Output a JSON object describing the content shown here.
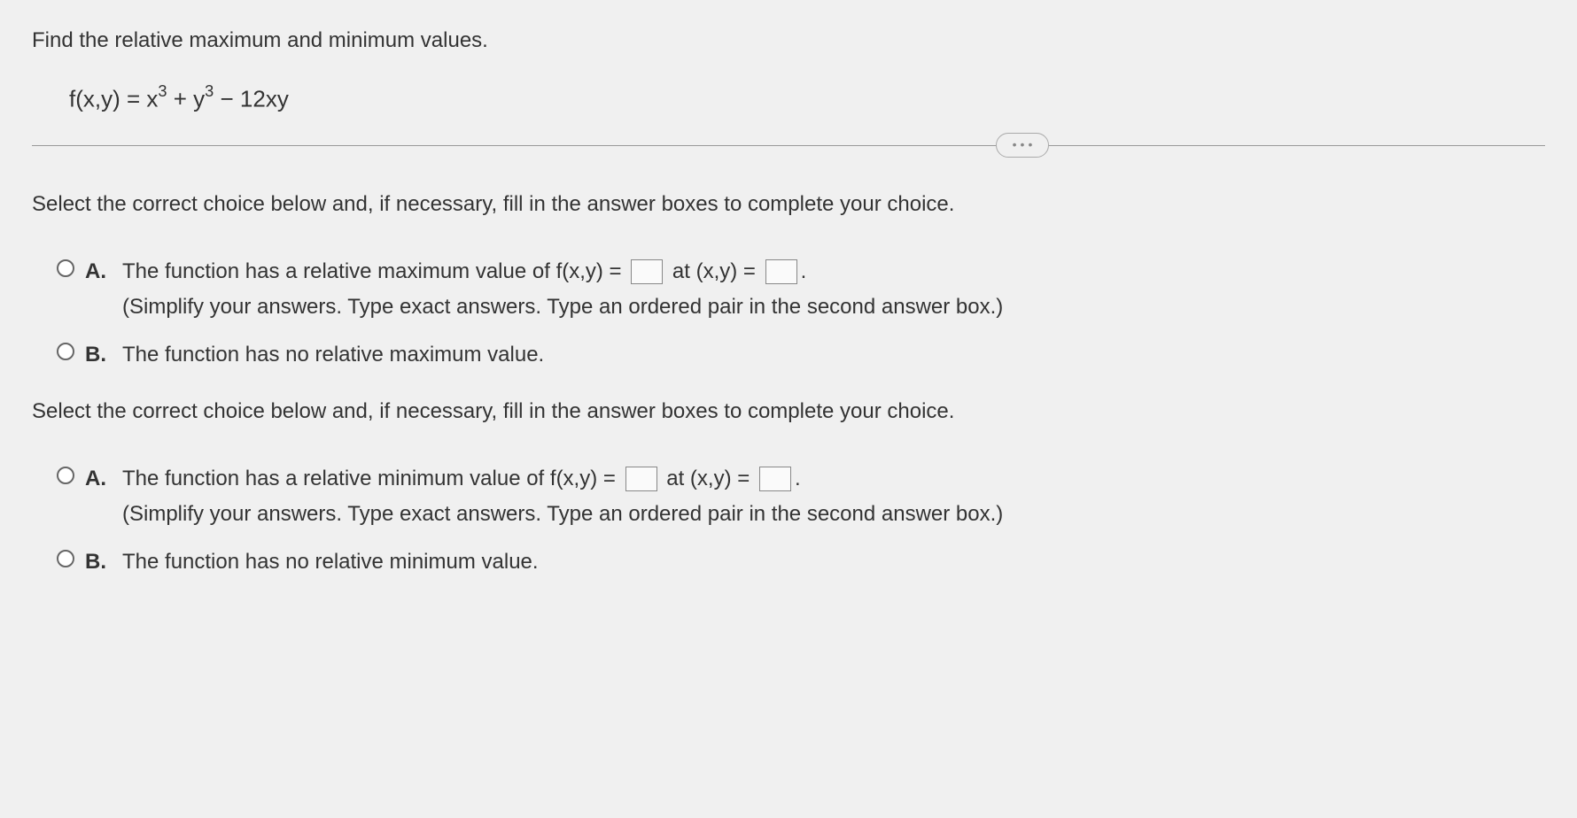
{
  "question": {
    "prompt": "Find the relative maximum and minimum values.",
    "formula_prefix": "f(x,y) = x",
    "formula_mid": " + y",
    "formula_suffix": " − 12xy",
    "exp1": "3",
    "exp2": "3"
  },
  "ellipsis": "•••",
  "part1": {
    "instruction": "Select the correct choice below and, if necessary, fill in the answer boxes to complete your choice.",
    "choiceA": {
      "letter": "A.",
      "text_before_box1": "The function has a relative maximum value of f(x,y) = ",
      "text_between": " at (x,y) = ",
      "text_after": ".",
      "hint": "(Simplify your answers. Type exact answers. Type an ordered pair in the second answer box.)"
    },
    "choiceB": {
      "letter": "B.",
      "text": "The function has no relative maximum value."
    }
  },
  "part2": {
    "instruction": "Select the correct choice below and, if necessary, fill in the answer boxes to complete your choice.",
    "choiceA": {
      "letter": "A.",
      "text_before_box1": "The function has a relative minimum value of f(x,y) = ",
      "text_between": " at (x,y) = ",
      "text_after": ".",
      "hint": "(Simplify your answers. Type exact answers. Type an ordered pair in the second answer box.)"
    },
    "choiceB": {
      "letter": "B.",
      "text": "The function has no relative minimum value."
    }
  }
}
